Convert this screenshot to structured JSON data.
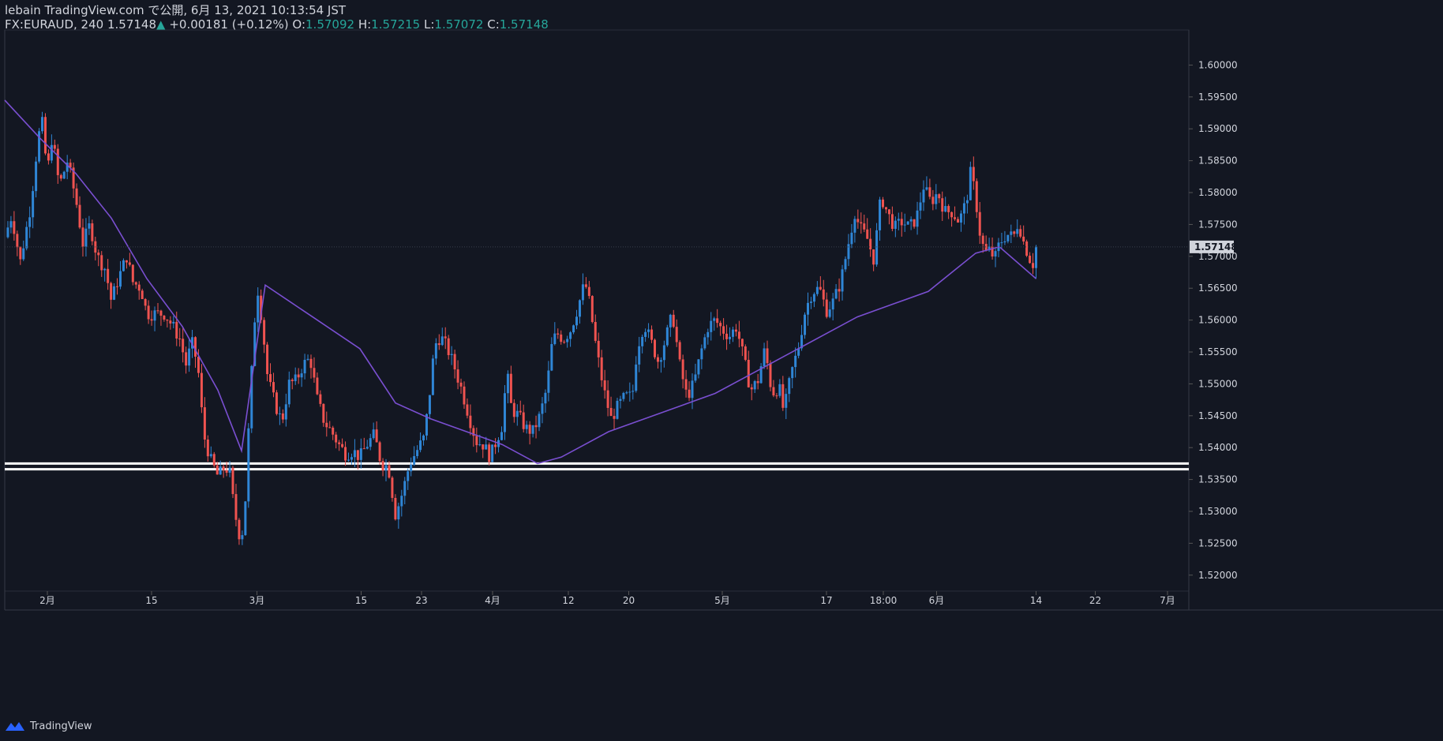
{
  "header": {
    "line1": "lebain TradingView.com で公開, 6月 13, 2021 10:13:54 JST",
    "symbol": "FX:EURAUD, 240",
    "last": "1.57148",
    "change": "+0.00181 (+0.12%)",
    "o_label": "O:",
    "o": "1.57092",
    "h_label": "H:",
    "h": "1.57215",
    "l_label": "L:",
    "l": "1.57072",
    "c_label": "C:",
    "c": "1.57148"
  },
  "footer": {
    "brand": "TradingView"
  },
  "colors": {
    "bg": "#131722",
    "up": "#2f86d6",
    "down": "#ef5350",
    "ma": "#7a4fd1",
    "grid": "#2a2e39",
    "text": "#d1d4dc",
    "ohlc": "#26a69a"
  },
  "chart_data": {
    "type": "line",
    "ylim": [
      1.5175,
      1.6055
    ],
    "yticks": [
      "1.52000",
      "1.52500",
      "1.53000",
      "1.53500",
      "1.54000",
      "1.54500",
      "1.55000",
      "1.55500",
      "1.56000",
      "1.56500",
      "1.57000",
      "1.57500",
      "1.58000",
      "1.58500",
      "1.59000",
      "1.59500",
      "1.60000"
    ],
    "ytick_values": [
      1.52,
      1.525,
      1.53,
      1.535,
      1.54,
      1.545,
      1.55,
      1.555,
      1.56,
      1.565,
      1.57,
      1.575,
      1.58,
      1.585,
      1.59,
      1.595,
      1.6
    ],
    "last_price_label": "1.57148",
    "last_price": 1.57148,
    "xticks": [
      {
        "label": "2月",
        "t": 0.036
      },
      {
        "label": "15",
        "t": 0.124
      },
      {
        "label": "3月",
        "t": 0.213
      },
      {
        "label": "15",
        "t": 0.301
      },
      {
        "label": "23",
        "t": 0.352
      },
      {
        "label": "4月",
        "t": 0.412
      },
      {
        "label": "12",
        "t": 0.476
      },
      {
        "label": "20",
        "t": 0.527
      },
      {
        "label": "5月",
        "t": 0.606
      },
      {
        "label": "17",
        "t": 0.694
      },
      {
        "label": "18:00",
        "t": 0.742
      },
      {
        "label": "6月",
        "t": 0.787
      },
      {
        "label": "14",
        "t": 0.871
      },
      {
        "label": "22",
        "t": 0.921
      },
      {
        "label": "7月",
        "t": 0.982
      }
    ],
    "price_path": [
      [
        0.0,
        1.573
      ],
      [
        0.006,
        1.5765
      ],
      [
        0.013,
        1.569
      ],
      [
        0.022,
        1.578
      ],
      [
        0.026,
        1.585
      ],
      [
        0.031,
        1.592
      ],
      [
        0.036,
        1.583
      ],
      [
        0.04,
        1.589
      ],
      [
        0.046,
        1.581
      ],
      [
        0.053,
        1.585
      ],
      [
        0.06,
        1.579
      ],
      [
        0.066,
        1.572
      ],
      [
        0.072,
        1.575
      ],
      [
        0.078,
        1.57
      ],
      [
        0.085,
        1.568
      ],
      [
        0.09,
        1.563
      ],
      [
        0.095,
        1.566
      ],
      [
        0.103,
        1.57
      ],
      [
        0.108,
        1.566
      ],
      [
        0.115,
        1.565
      ],
      [
        0.12,
        1.561
      ],
      [
        0.128,
        1.561
      ],
      [
        0.135,
        1.561
      ],
      [
        0.142,
        1.559
      ],
      [
        0.148,
        1.557
      ],
      [
        0.153,
        1.553
      ],
      [
        0.158,
        1.5565
      ],
      [
        0.163,
        1.553
      ],
      [
        0.168,
        1.542
      ],
      [
        0.174,
        1.538
      ],
      [
        0.18,
        1.5355
      ],
      [
        0.186,
        1.537
      ],
      [
        0.19,
        1.536
      ],
      [
        0.194,
        1.53
      ],
      [
        0.198,
        1.5265
      ],
      [
        0.202,
        1.527
      ],
      [
        0.207,
        1.547
      ],
      [
        0.211,
        1.56
      ],
      [
        0.214,
        1.565
      ],
      [
        0.218,
        1.5585
      ],
      [
        0.222,
        1.551
      ],
      [
        0.228,
        1.547
      ],
      [
        0.234,
        1.544
      ],
      [
        0.24,
        1.55
      ],
      [
        0.246,
        1.5505
      ],
      [
        0.252,
        1.553
      ],
      [
        0.258,
        1.554
      ],
      [
        0.264,
        1.5475
      ],
      [
        0.27,
        1.544
      ],
      [
        0.276,
        1.5425
      ],
      [
        0.282,
        1.5405
      ],
      [
        0.288,
        1.539
      ],
      [
        0.294,
        1.5395
      ],
      [
        0.3,
        1.5385
      ],
      [
        0.306,
        1.5405
      ],
      [
        0.312,
        1.542
      ],
      [
        0.318,
        1.5375
      ],
      [
        0.324,
        1.537
      ],
      [
        0.33,
        1.5295
      ],
      [
        0.336,
        1.533
      ],
      [
        0.342,
        1.5375
      ],
      [
        0.348,
        1.5395
      ],
      [
        0.354,
        1.5415
      ],
      [
        0.358,
        1.547
      ],
      [
        0.363,
        1.556
      ],
      [
        0.368,
        1.5575
      ],
      [
        0.374,
        1.5555
      ],
      [
        0.38,
        1.5525
      ],
      [
        0.386,
        1.549
      ],
      [
        0.392,
        1.545
      ],
      [
        0.398,
        1.541
      ],
      [
        0.404,
        1.5405
      ],
      [
        0.41,
        1.5385
      ],
      [
        0.416,
        1.5415
      ],
      [
        0.42,
        1.5435
      ],
      [
        0.424,
        1.552
      ],
      [
        0.428,
        1.546
      ],
      [
        0.434,
        1.545
      ],
      [
        0.44,
        1.543
      ],
      [
        0.446,
        1.5425
      ],
      [
        0.452,
        1.545
      ],
      [
        0.458,
        1.5495
      ],
      [
        0.462,
        1.556
      ],
      [
        0.466,
        1.558
      ],
      [
        0.472,
        1.557
      ],
      [
        0.478,
        1.5585
      ],
      [
        0.484,
        1.562
      ],
      [
        0.49,
        1.566
      ],
      [
        0.494,
        1.5625
      ],
      [
        0.5,
        1.555
      ],
      [
        0.506,
        1.549
      ],
      [
        0.512,
        1.5445
      ],
      [
        0.518,
        1.5465
      ],
      [
        0.524,
        1.548
      ],
      [
        0.53,
        1.548
      ],
      [
        0.534,
        1.5555
      ],
      [
        0.54,
        1.5595
      ],
      [
        0.546,
        1.5565
      ],
      [
        0.552,
        1.5535
      ],
      [
        0.558,
        1.557
      ],
      [
        0.564,
        1.561
      ],
      [
        0.57,
        1.553
      ],
      [
        0.576,
        1.548
      ],
      [
        0.582,
        1.55
      ],
      [
        0.588,
        1.555
      ],
      [
        0.594,
        1.559
      ],
      [
        0.6,
        1.56
      ],
      [
        0.606,
        1.5585
      ],
      [
        0.612,
        1.5575
      ],
      [
        0.618,
        1.559
      ],
      [
        0.624,
        1.554
      ],
      [
        0.63,
        1.549
      ],
      [
        0.636,
        1.5505
      ],
      [
        0.642,
        1.5555
      ],
      [
        0.648,
        1.5485
      ],
      [
        0.654,
        1.5495
      ],
      [
        0.658,
        1.5455
      ],
      [
        0.664,
        1.5515
      ],
      [
        0.67,
        1.5555
      ],
      [
        0.676,
        1.5615
      ],
      [
        0.682,
        1.5645
      ],
      [
        0.688,
        1.565
      ],
      [
        0.694,
        1.5615
      ],
      [
        0.7,
        1.563
      ],
      [
        0.706,
        1.566
      ],
      [
        0.712,
        1.5715
      ],
      [
        0.718,
        1.577
      ],
      [
        0.722,
        1.5745
      ],
      [
        0.728,
        1.573
      ],
      [
        0.734,
        1.5695
      ],
      [
        0.74,
        1.5795
      ],
      [
        0.746,
        1.5765
      ],
      [
        0.752,
        1.5745
      ],
      [
        0.758,
        1.5755
      ],
      [
        0.764,
        1.5745
      ],
      [
        0.77,
        1.576
      ],
      [
        0.776,
        1.581
      ],
      [
        0.782,
        1.5785
      ],
      [
        0.788,
        1.58
      ],
      [
        0.794,
        1.577
      ],
      [
        0.8,
        1.577
      ],
      [
        0.806,
        1.5755
      ],
      [
        0.812,
        1.5785
      ],
      [
        0.816,
        1.5835
      ],
      [
        0.82,
        1.579
      ],
      [
        0.824,
        1.573
      ],
      [
        0.828,
        1.5705
      ],
      [
        0.832,
        1.571
      ],
      [
        0.836,
        1.5695
      ],
      [
        0.84,
        1.572
      ],
      [
        0.846,
        1.5735
      ],
      [
        0.852,
        1.573
      ],
      [
        0.856,
        1.5755
      ],
      [
        0.86,
        1.5725
      ],
      [
        0.864,
        1.5705
      ],
      [
        0.868,
        1.5685
      ],
      [
        0.871,
        1.5714
      ]
    ],
    "series": [
      {
        "values": [
          [
            0.0,
            1.5945
          ],
          [
            0.03,
            1.5885
          ],
          [
            0.06,
            1.583
          ],
          [
            0.09,
            1.576
          ],
          [
            0.12,
            1.5665
          ],
          [
            0.15,
            1.559
          ],
          [
            0.18,
            1.549
          ],
          [
            0.2,
            1.5395
          ],
          [
            0.22,
            1.5655
          ],
          [
            0.26,
            1.5605
          ],
          [
            0.3,
            1.5555
          ],
          [
            0.33,
            1.547
          ],
          [
            0.36,
            1.5445
          ],
          [
            0.39,
            1.5425
          ],
          [
            0.42,
            1.5405
          ],
          [
            0.45,
            1.5375
          ],
          [
            0.47,
            1.5385
          ],
          [
            0.49,
            1.5405
          ],
          [
            0.51,
            1.5425
          ],
          [
            0.54,
            1.5445
          ],
          [
            0.57,
            1.5465
          ],
          [
            0.6,
            1.5485
          ],
          [
            0.63,
            1.5515
          ],
          [
            0.66,
            1.5545
          ],
          [
            0.69,
            1.5575
          ],
          [
            0.72,
            1.5605
          ],
          [
            0.75,
            1.5625
          ],
          [
            0.78,
            1.5645
          ],
          [
            0.8,
            1.5675
          ],
          [
            0.82,
            1.5705
          ],
          [
            0.84,
            1.5715
          ],
          [
            0.871,
            1.5665
          ]
        ]
      }
    ],
    "support_lines": [
      1.5375,
      1.5366
    ]
  }
}
